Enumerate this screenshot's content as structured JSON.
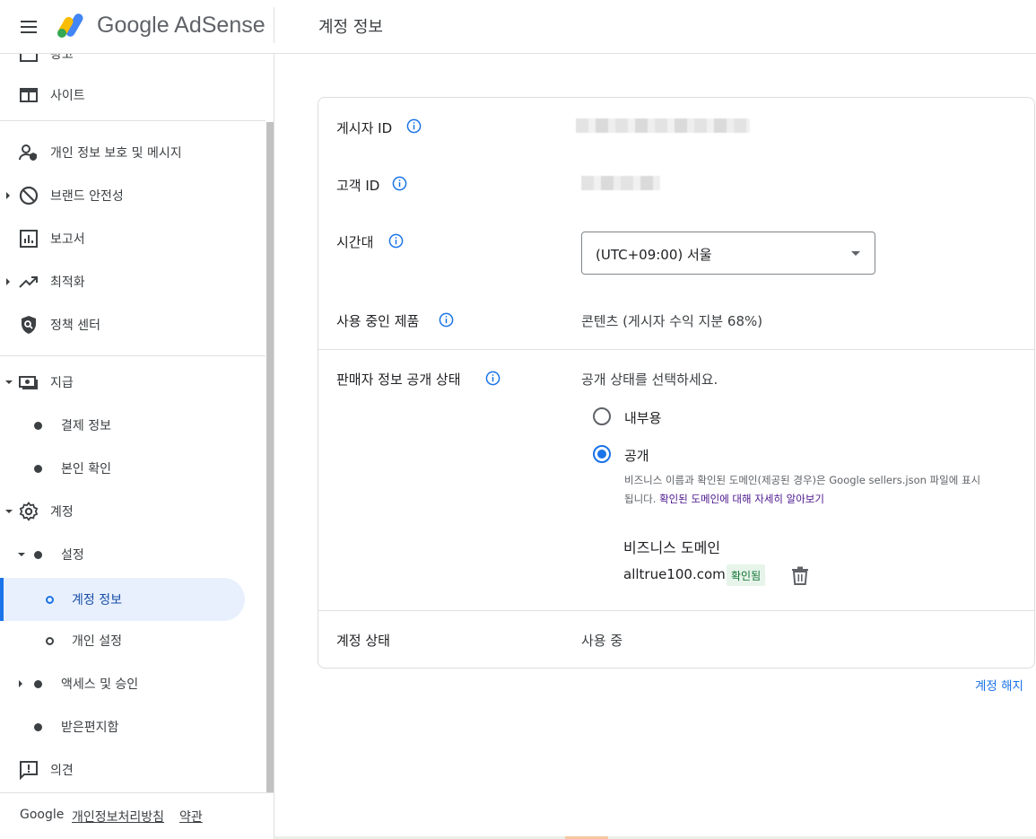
{
  "header": {
    "brand": "Google AdSense",
    "page_title": "계정 정보",
    "icons": [
      "menu-icon",
      "adsense-logo"
    ]
  },
  "sidebar": {
    "items": [
      {
        "label": "광고",
        "icon": "ads-icon"
      },
      {
        "label": "사이트",
        "icon": "sites-icon"
      },
      {
        "label": "개인 정보 보호 및 메시지",
        "icon": "privacy-icon"
      },
      {
        "label": "브랜드 안전성",
        "icon": "block-icon"
      },
      {
        "label": "보고서",
        "icon": "report-icon"
      },
      {
        "label": "최적화",
        "icon": "trending-up-icon"
      },
      {
        "label": "정책 센터",
        "icon": "shield-icon"
      },
      {
        "label": "지급",
        "icon": "payments-icon"
      },
      {
        "label": "결제 정보"
      },
      {
        "label": "본인 확인"
      },
      {
        "label": "계정",
        "icon": "gear-icon"
      },
      {
        "label": "설정"
      },
      {
        "label": "계정 정보"
      },
      {
        "label": "개인 설정"
      },
      {
        "label": "액세스 및 승인"
      },
      {
        "label": "받은편지함"
      },
      {
        "label": "의견",
        "icon": "feedback-icon"
      }
    ],
    "footer": {
      "google": "Google",
      "privacy": "개인정보처리방침",
      "terms": "약관"
    }
  },
  "account": {
    "publisher_id_label": "게시자 ID",
    "customer_id_label": "고객 ID",
    "timezone_label": "시간대",
    "timezone_value": "(UTC+09:00) 서울",
    "products_label": "사용 중인 제품",
    "products_value": "콘텐츠 (게시자 수익 지분 68%)",
    "seller_label": "판매자 정보 공개 상태",
    "seller_prompt": "공개 상태를 선택하세요.",
    "radio_internal": "내부용",
    "radio_public": "공개",
    "radio_selected": "공개",
    "help_text": "비즈니스 이름과 확인된 도메인(제공된 경우)은 Google sellers.json 파일에 표시됩니다.",
    "help_link": "확인된 도메인에 대해 자세히 알아보기",
    "domain_title": "비즈니스 도메인",
    "domain_value": "alltrue100.com",
    "domain_badge": "확인됨",
    "status_label": "계정 상태",
    "status_value": "사용 중",
    "terminate_link": "계정 해지"
  },
  "colors": {
    "accent": "#1a73e8",
    "active_bg": "#e8f0fe",
    "badge_bg": "#e6f4ea",
    "badge_text": "#137333"
  }
}
